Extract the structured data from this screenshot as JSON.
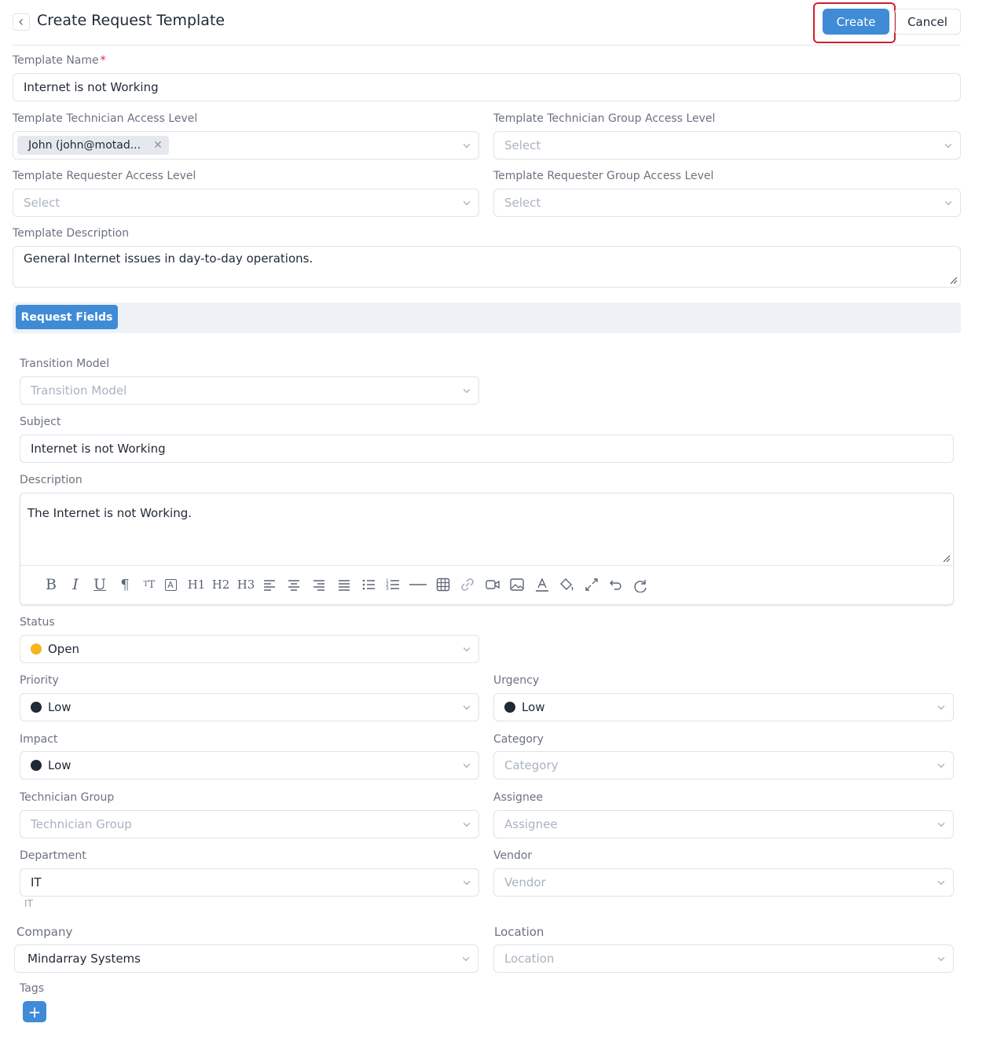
{
  "header": {
    "title": "Create Request Template",
    "create_label": "Create",
    "cancel_label": "Cancel"
  },
  "form": {
    "template_name": {
      "label": "Template Name",
      "required_mark": "*",
      "value": "Internet is not Working"
    },
    "tech_access": {
      "label": "Template Technician Access Level",
      "chip": "John (john@motad..."
    },
    "tech_group_access": {
      "label": "Template Technician Group Access Level",
      "placeholder": "Select"
    },
    "requester_access": {
      "label": "Template Requester Access Level",
      "placeholder": "Select"
    },
    "requester_group_access": {
      "label": "Template Requester Group Access Level",
      "placeholder": "Select"
    },
    "description": {
      "label": "Template Description",
      "value": "General Internet issues in day-to-day operations."
    }
  },
  "tabs": {
    "request_fields": "Request Fields"
  },
  "request": {
    "transition_model": {
      "label": "Transition Model",
      "placeholder": "Transition Model"
    },
    "subject": {
      "label": "Subject",
      "value": "Internet is not Working"
    },
    "description": {
      "label": "Description",
      "value": "The Internet is not Working."
    },
    "toolbar": {
      "icons": [
        "bold-icon",
        "italic-icon",
        "underline-icon",
        "paragraph-icon",
        "font-size-icon",
        "text-box-icon",
        "heading-1-icon",
        "heading-2-icon",
        "heading-3-icon",
        "align-left-icon",
        "align-center-icon",
        "align-right-icon",
        "align-justify-icon",
        "bullet-list-icon",
        "numbered-list-icon",
        "horizontal-rule-icon",
        "table-icon",
        "link-icon",
        "video-icon",
        "image-icon",
        "text-color-icon",
        "fill-color-icon",
        "expand-icon",
        "undo-icon",
        "redo-icon"
      ],
      "h1": "H1",
      "h2": "H2",
      "h3": "H3"
    },
    "status": {
      "label": "Status",
      "value": "Open",
      "color": "#f5b51b"
    },
    "priority": {
      "label": "Priority",
      "value": "Low",
      "color": "#1f2937"
    },
    "urgency": {
      "label": "Urgency",
      "value": "Low",
      "color": "#1f2937"
    },
    "impact": {
      "label": "Impact",
      "value": "Low",
      "color": "#1f2937"
    },
    "category": {
      "label": "Category",
      "placeholder": "Category"
    },
    "technician_group": {
      "label": "Technician Group",
      "placeholder": "Technician Group"
    },
    "assignee": {
      "label": "Assignee",
      "placeholder": "Assignee"
    },
    "department": {
      "label": "Department",
      "value": "IT",
      "hint": "IT"
    },
    "vendor": {
      "label": "Vendor",
      "placeholder": "Vendor"
    },
    "company": {
      "label": "Company",
      "value": "Mindarray Systems"
    },
    "location": {
      "label": "Location",
      "placeholder": "Location"
    },
    "tags": {
      "label": "Tags",
      "add_symbol": "+"
    }
  },
  "colors": {
    "accent": "#3f8bd6",
    "highlight": "#d0202e"
  }
}
